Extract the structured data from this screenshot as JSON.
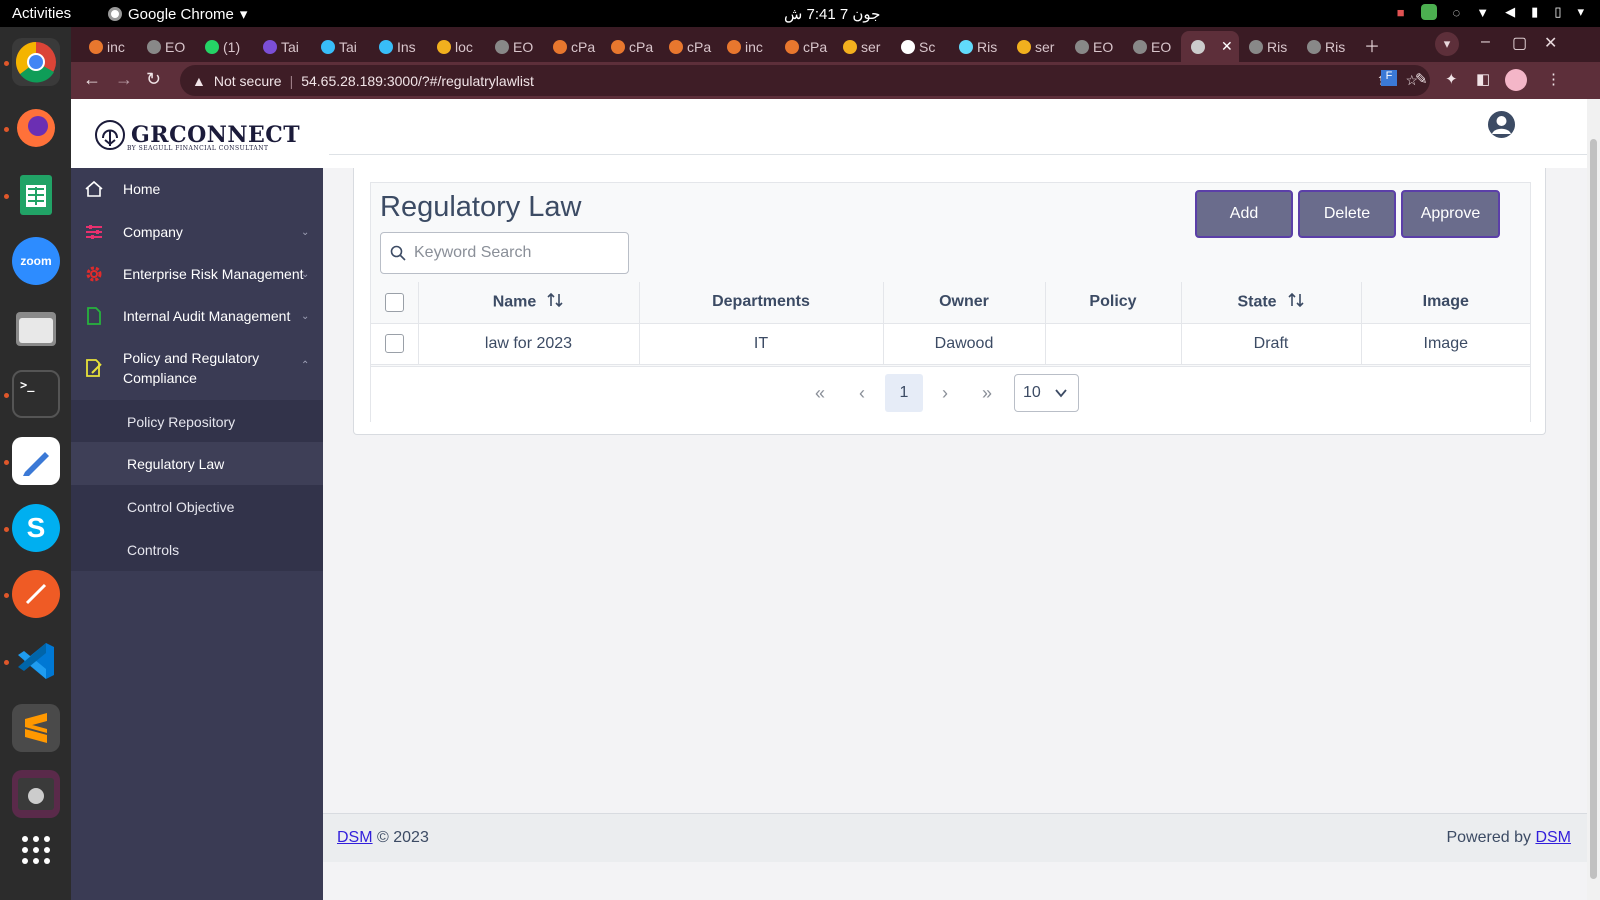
{
  "os": {
    "activities": "Activities",
    "app_name": "Google Chrome",
    "clock": "جون 7  7:41 ش"
  },
  "browser": {
    "tabs": [
      "inc",
      "EO",
      "(1)",
      "Tai",
      "Tai",
      "Ins",
      "loc",
      "EO",
      "cPa",
      "cPa",
      "cPa",
      "inc",
      "cPa",
      "ser",
      "Sc",
      "Ris",
      "ser",
      "EO",
      "EO",
      "",
      "Ris",
      "Ris"
    ],
    "active_tab_index": 19,
    "security_label": "Not secure",
    "url": "54.65.28.189:3000/?#/regulatrylawlist"
  },
  "app": {
    "logo": {
      "name": "GRCONNECT",
      "tagline": "BY SEAGULL FINANCIAL CONSULTANT"
    },
    "sidebar": {
      "items": [
        {
          "label": "Home"
        },
        {
          "label": "Company"
        },
        {
          "label": "Enterprise Risk Management"
        },
        {
          "label": "Internal Audit Management"
        },
        {
          "label": "Policy and Regulatory",
          "label2": "Compliance"
        }
      ],
      "subitems": [
        {
          "label": "Policy Repository"
        },
        {
          "label": "Regulatory Law"
        },
        {
          "label": "Control Objective"
        },
        {
          "label": "Controls"
        }
      ],
      "active_subitem": "Regulatory Law"
    },
    "page": {
      "title": "Regulatory Law",
      "search_placeholder": "Keyword Search",
      "buttons": {
        "add": "Add",
        "delete": "Delete",
        "approve": "Approve"
      },
      "table": {
        "headers": [
          "Name",
          "Departments",
          "Owner",
          "Policy",
          "State",
          "Image"
        ],
        "rows": [
          {
            "name": "law for 2023",
            "departments": "IT",
            "owner": "Dawood",
            "policy": "",
            "state": "Draft",
            "image": "Image"
          }
        ]
      },
      "pagination": {
        "first": "«",
        "prev": "‹",
        "current": "1",
        "next": "›",
        "last": "»",
        "per_page": "10"
      }
    },
    "footer": {
      "left_link": "DSM",
      "left_text": "© 2023",
      "right_text": "Powered by",
      "right_link": "DSM"
    }
  },
  "colors": {
    "sidebar_bg": "#3a3b54",
    "button_bg": "#6a6c8c",
    "button_border": "#5b3fa8",
    "link": "#321fdb",
    "chrome_tabstrip": "#3a1b24",
    "chrome_toolbar": "#5d2f3a"
  }
}
